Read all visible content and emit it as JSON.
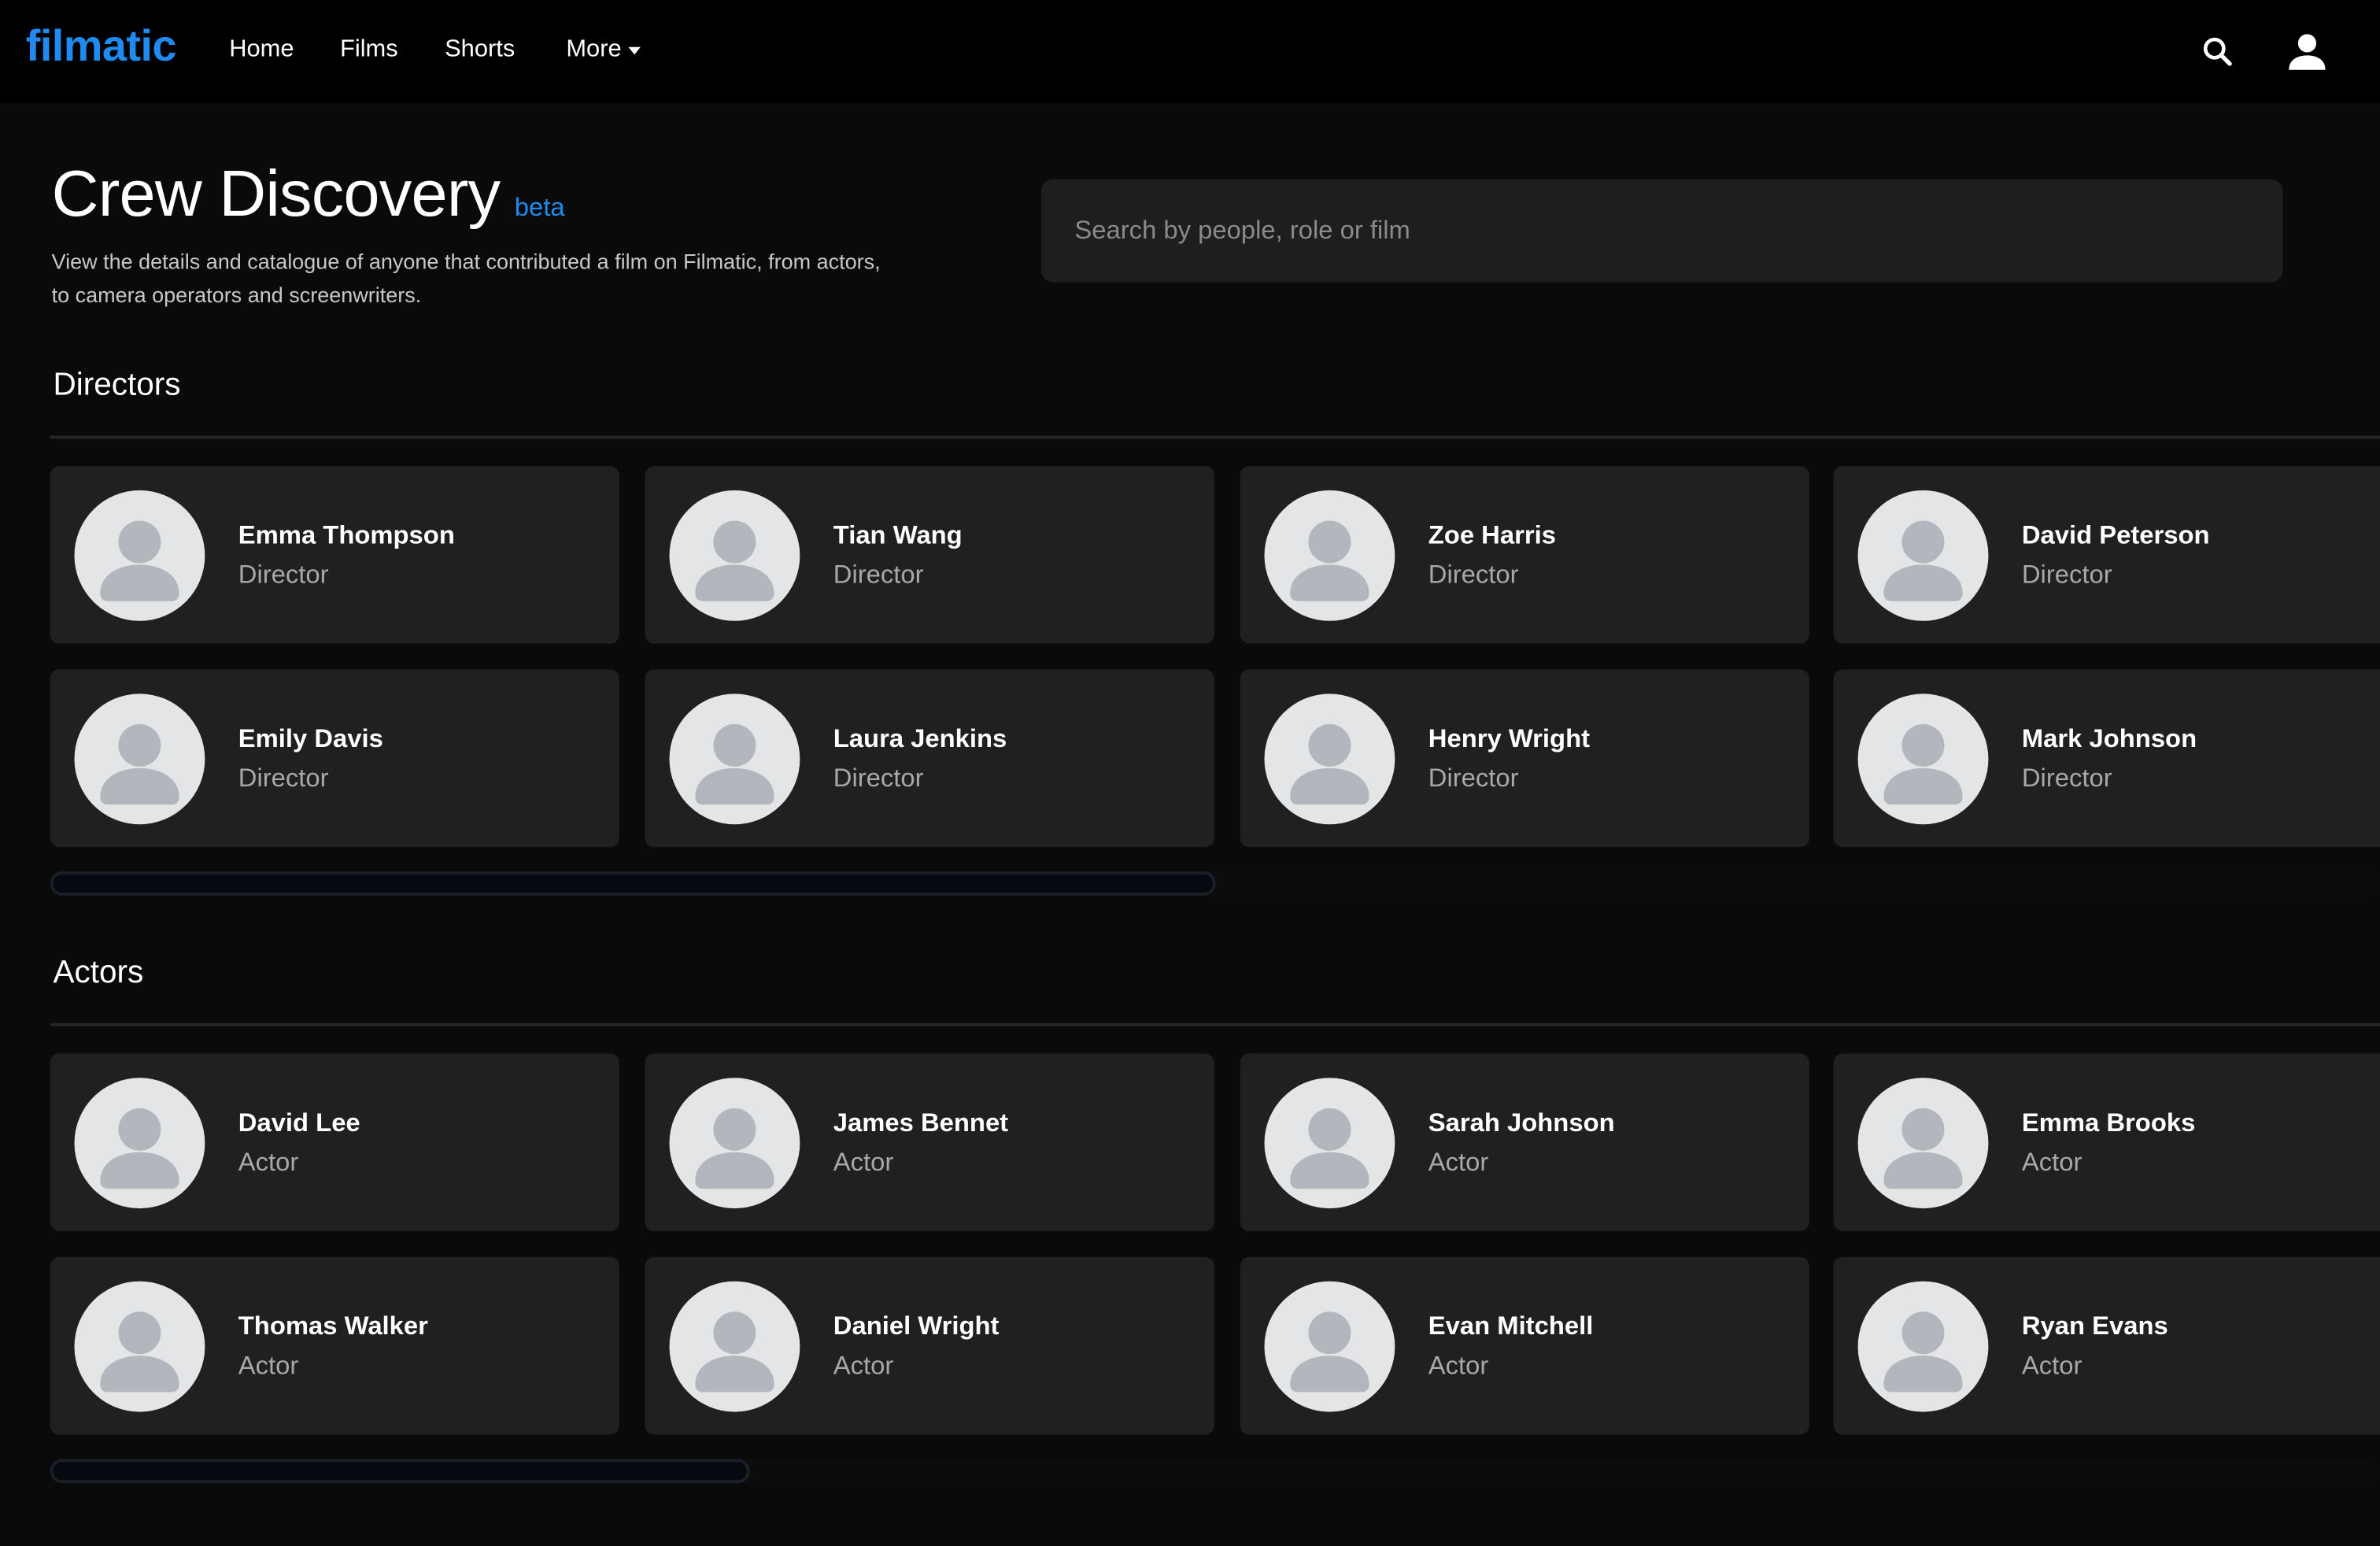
{
  "header": {
    "logo": "filmatic",
    "nav": {
      "home": "Home",
      "films": "Films",
      "shorts": "Shorts",
      "more": "More"
    },
    "icons": [
      "search-icon",
      "user-icon"
    ]
  },
  "page": {
    "title": "Crew Discovery",
    "badge": "beta",
    "description": "View the details and catalogue of anyone that contributed a film on Filmatic, from actors, to camera operators and screenwriters."
  },
  "search": {
    "placeholder": "Search by people, role or film",
    "value": ""
  },
  "sections": {
    "directors": {
      "title": "Directors",
      "scroll_fraction": 0.5,
      "people": [
        {
          "name": "Emma Thompson",
          "role": "Director"
        },
        {
          "name": "Tian Wang",
          "role": "Director"
        },
        {
          "name": "Zoe Harris",
          "role": "Director"
        },
        {
          "name": "David Peterson",
          "role": "Director"
        },
        {
          "name": "Emily Davis",
          "role": "Director"
        },
        {
          "name": "Laura Jenkins",
          "role": "Director"
        },
        {
          "name": "Henry Wright",
          "role": "Director"
        },
        {
          "name": "Mark Johnson",
          "role": "Director"
        }
      ]
    },
    "actors": {
      "title": "Actors",
      "scroll_fraction": 0.3,
      "people": [
        {
          "name": "David Lee",
          "role": "Actor"
        },
        {
          "name": "James Bennet",
          "role": "Actor"
        },
        {
          "name": "Sarah Johnson",
          "role": "Actor"
        },
        {
          "name": "Emma Brooks",
          "role": "Actor"
        },
        {
          "name": "Thomas Walker",
          "role": "Actor"
        },
        {
          "name": "Daniel Wright",
          "role": "Actor"
        },
        {
          "name": "Evan Mitchell",
          "role": "Actor"
        },
        {
          "name": "Ryan Evans",
          "role": "Actor"
        }
      ]
    }
  },
  "colors": {
    "accent": "#1f8bf0",
    "background": "#0a0a0a",
    "card": "#202020",
    "avatar": "#e4e5e7",
    "avatar_figure": "#b3b7bd"
  }
}
